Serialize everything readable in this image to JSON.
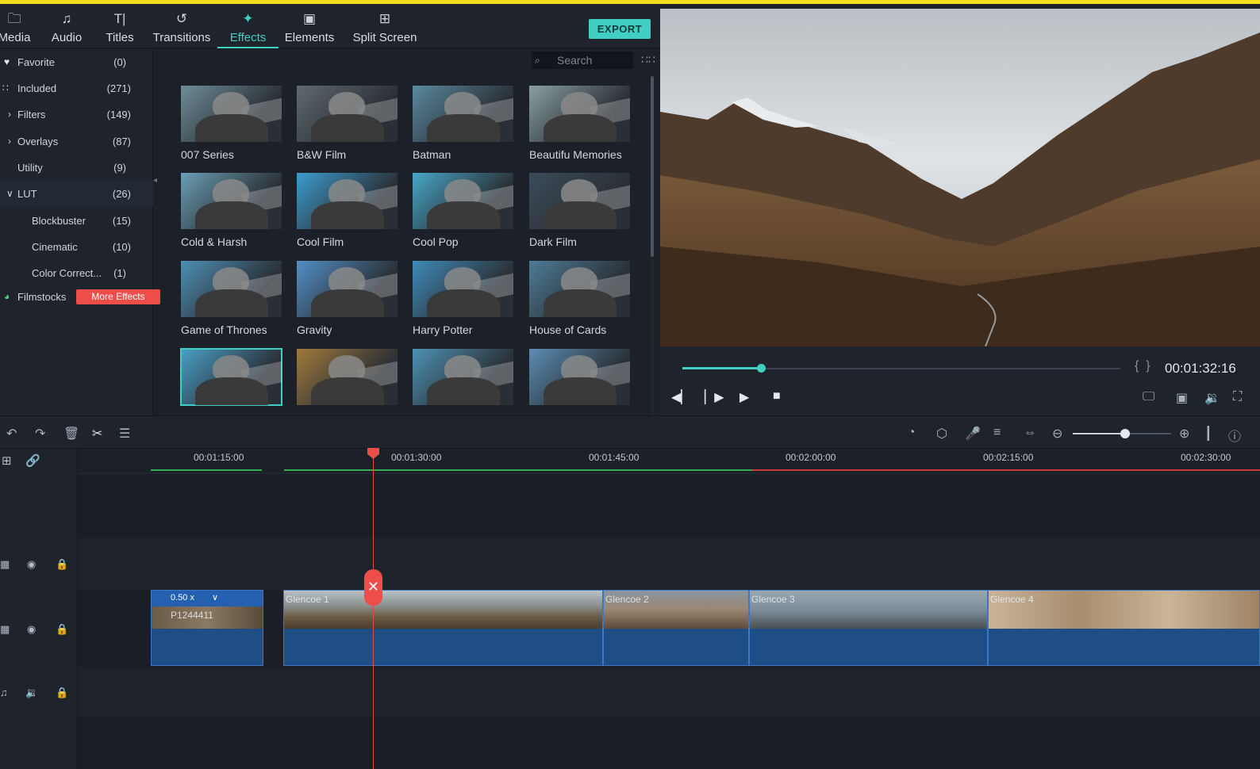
{
  "nav": {
    "tabs": [
      {
        "label": "Media",
        "icon": "folder-icon"
      },
      {
        "label": "Audio",
        "icon": "music-note-icon"
      },
      {
        "label": "Titles",
        "icon": "text-icon"
      },
      {
        "label": "Transitions",
        "icon": "transition-icon"
      },
      {
        "label": "Effects",
        "icon": "effects-icon",
        "active": true
      },
      {
        "label": "Elements",
        "icon": "image-icon"
      },
      {
        "label": "Split Screen",
        "icon": "split-screen-icon"
      }
    ],
    "export_label": "EXPORT"
  },
  "sidebar": {
    "items": [
      {
        "label": "Favorite",
        "count": "(0)",
        "icon": "heart-icon"
      },
      {
        "label": "Included",
        "count": "(271)",
        "icon": "grid-icon"
      },
      {
        "label": "Filters",
        "count": "(149)",
        "icon": "chevron-right-icon"
      },
      {
        "label": "Overlays",
        "count": "(87)",
        "icon": "chevron-right-icon"
      },
      {
        "label": "Utility",
        "count": "(9)"
      },
      {
        "label": "LUT",
        "count": "(26)",
        "icon": "chevron-down-icon"
      },
      {
        "label": "Blockbuster",
        "count": "(15)"
      },
      {
        "label": "Cinematic",
        "count": "(10)"
      },
      {
        "label": "Color Correct...",
        "count": "(1)"
      },
      {
        "label": "Filmstocks",
        "icon": "filmstocks-icon"
      }
    ],
    "more_effects": "More Effects"
  },
  "effects": {
    "search_placeholder": "Search",
    "items": [
      "007 Series",
      "B&W Film",
      "Batman",
      "Beautifu Memories",
      "Cold & Harsh",
      "Cool Film",
      "Cool Pop",
      "Dark Film",
      "Game of Thrones",
      "Gravity",
      "Harry Potter",
      "House of Cards",
      "",
      "",
      "",
      ""
    ]
  },
  "preview": {
    "timecode": "00:01:32:16",
    "progress": 0.18
  },
  "timeline": {
    "ruler": [
      "00:01:15:00",
      "00:01:30:00",
      "00:01:45:00",
      "00:02:00:00",
      "00:02:15:00",
      "00:02:30:00"
    ],
    "clips": {
      "speed": "0.50 x",
      "first_clip": "P1244411",
      "clip1": "Glencoe 1",
      "clip2": "Glencoe 2",
      "clip3": "Glencoe 3",
      "clip4": "Glencoe 4"
    },
    "zoom": 0.53
  },
  "colors": {
    "accent": "#40cfc2",
    "playhead": "#ee4e4a",
    "clip": "#1f4d86"
  }
}
